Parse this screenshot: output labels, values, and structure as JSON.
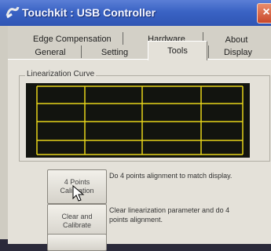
{
  "window": {
    "title": "Touchkit : USB Controller",
    "close_glyph": "×"
  },
  "tabs": {
    "row1": [
      "Edge Compensation",
      "Hardware",
      "About"
    ],
    "row2": [
      "General",
      "Setting",
      "Tools",
      "Display"
    ],
    "active": "Tools"
  },
  "linearization": {
    "group_label": "Linearization Curve",
    "grid_color": "#e6d41a"
  },
  "actions": [
    {
      "button_label": "4 Points Calibration",
      "description": "Do 4 points alignment to match display."
    },
    {
      "button_label": "Clear and Calibrate",
      "description": "Clear linearization parameter and do 4 points alignment."
    }
  ],
  "colors": {
    "titlebar": "#3a63c4",
    "panel": "#e4e1d9",
    "close": "#c9482a"
  }
}
